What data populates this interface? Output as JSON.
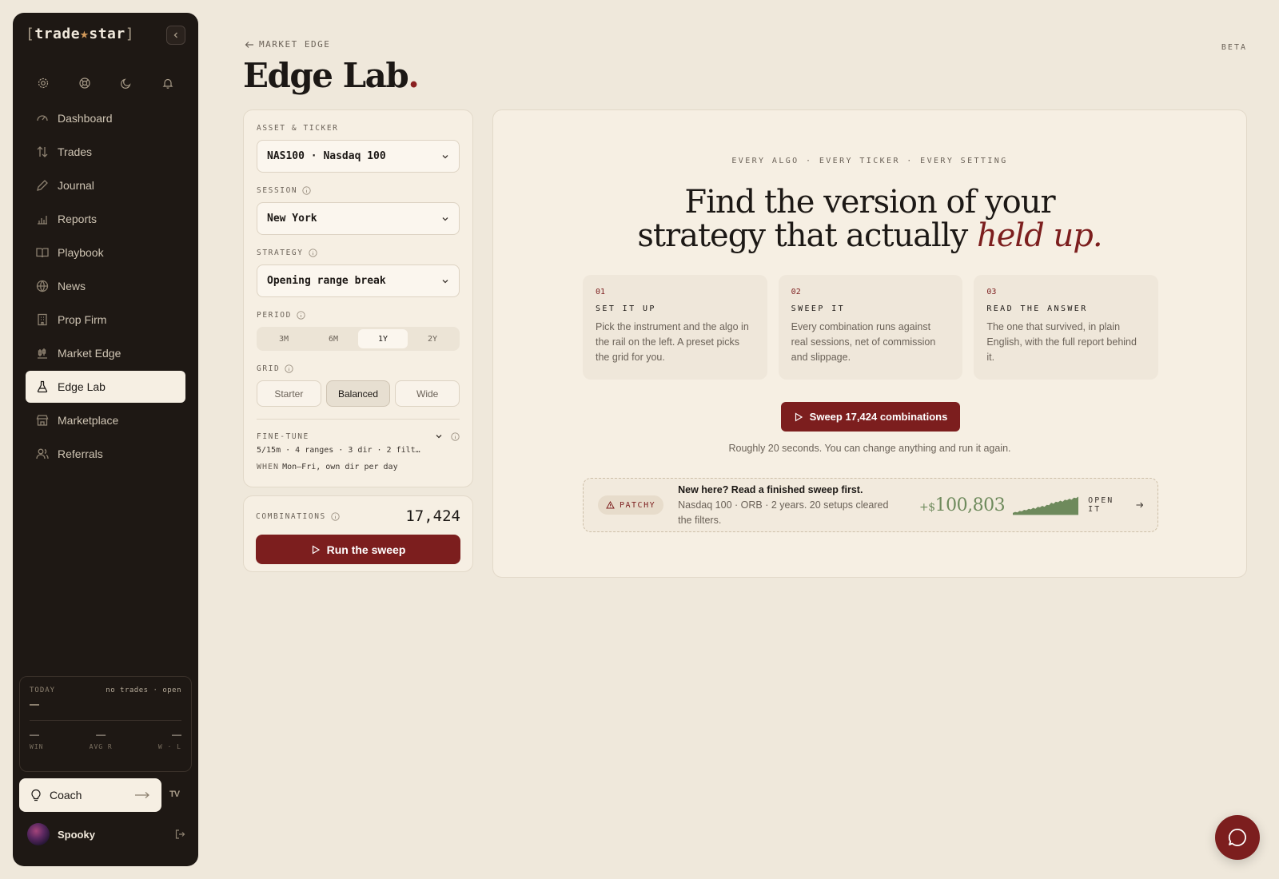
{
  "app": {
    "logo_open": "[",
    "logo_trade": "trade",
    "logo_star": "★",
    "logo_star_word": "star",
    "logo_close": "]"
  },
  "sidebar": {
    "items": [
      {
        "label": "Dashboard",
        "icon": "gauge-icon"
      },
      {
        "label": "Trades",
        "icon": "sort-arrows-icon"
      },
      {
        "label": "Journal",
        "icon": "pen-icon"
      },
      {
        "label": "Reports",
        "icon": "bar-chart-icon"
      },
      {
        "label": "Playbook",
        "icon": "book-icon"
      },
      {
        "label": "News",
        "icon": "globe-icon"
      },
      {
        "label": "Prop Firm",
        "icon": "building-icon"
      },
      {
        "label": "Market Edge",
        "icon": "candlestick-icon"
      },
      {
        "label": "Edge Lab",
        "icon": "flask-icon",
        "active": true
      },
      {
        "label": "Marketplace",
        "icon": "store-icon"
      },
      {
        "label": "Referrals",
        "icon": "users-icon"
      }
    ],
    "today": {
      "label": "TODAY",
      "status": "no trades · open",
      "stats": [
        {
          "value": "—",
          "label": "WIN"
        },
        {
          "value": "—",
          "label": "AVG R"
        },
        {
          "value": "—",
          "label": "W · L"
        }
      ]
    },
    "coach_label": "Coach",
    "tv_label": "TV",
    "user_name": "Spooky"
  },
  "header": {
    "breadcrumb": "MARKET EDGE",
    "title": "Edge Lab",
    "title_dot": ".",
    "beta": "BETA"
  },
  "config": {
    "asset_label": "ASSET & TICKER",
    "asset_value": "NAS100 · Nasdaq 100",
    "session_label": "SESSION",
    "session_value": "New York",
    "strategy_label": "STRATEGY",
    "strategy_value": "Opening range break",
    "period_label": "PERIOD",
    "periods": [
      "3M",
      "6M",
      "1Y",
      "2Y"
    ],
    "period_selected": "1Y",
    "grid_label": "GRID",
    "grids": [
      "Starter",
      "Balanced",
      "Wide"
    ],
    "grid_selected": "Balanced",
    "finetune_label": "FINE-TUNE",
    "finetune_summary": "5/15m · 4 ranges · 3 dir · 2 filt…",
    "finetune_when_key": "WHEN",
    "finetune_when_value": "Mon–Fri, own dir per day",
    "combinations_label": "COMBINATIONS",
    "combinations_value": "17,424",
    "run_label": "Run the sweep"
  },
  "hero": {
    "eyebrow": "EVERY ALGO · EVERY TICKER · EVERY SETTING",
    "headline_line1": "Find the version of your",
    "headline_line2": "strategy that actually",
    "headline_em": "held up.",
    "steps": [
      {
        "num": "01",
        "title": "SET IT UP",
        "body": "Pick the instrument and the algo in the rail on the left. A preset picks the grid for you."
      },
      {
        "num": "02",
        "title": "SWEEP IT",
        "body": "Every combination runs against real sessions, net of commission and slippage."
      },
      {
        "num": "03",
        "title": "READ THE ANSWER",
        "body": "The one that survived, in plain English, with the full report behind it."
      }
    ],
    "sweep_label": "Sweep 17,424 combinations",
    "sweep_note": "Roughly 20 seconds. You can change anything and run it again.",
    "example": {
      "badge": "PATCHY",
      "lead": "New here? Read a finished sweep first.",
      "detail": "Nasdaq 100 · ORB · 2 years. 20 setups cleared the filters.",
      "amount_sign": "+$",
      "amount": "100,803",
      "open_label": "OPEN IT",
      "equity_curve": [
        2,
        3,
        2.5,
        4,
        3.5,
        5,
        4.5,
        6,
        5.5,
        7,
        6,
        8,
        7.5,
        9,
        8,
        10,
        9.5,
        12,
        11,
        13,
        12.5,
        14,
        13,
        15,
        14.5,
        16,
        15,
        17,
        16.5,
        18
      ]
    },
    "accent_color": "#7c1e1e",
    "gain_color": "#6e8a5c"
  }
}
